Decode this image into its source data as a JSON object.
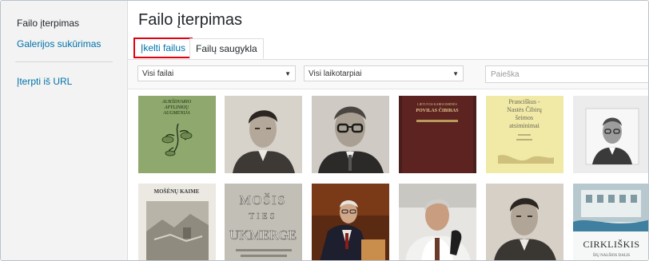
{
  "sidebar": {
    "items": [
      {
        "label": "Failo įterpimas"
      },
      {
        "label": "Galerijos sukūrimas"
      },
      {
        "label": "Įterpti iš URL"
      }
    ]
  },
  "main": {
    "title": "Failo įterpimas",
    "tabs": [
      {
        "label": "Įkelti failus"
      },
      {
        "label": "Failų saugykla"
      }
    ],
    "filters": {
      "type": "Visi failai",
      "date": "Visi laikotarpiai",
      "search_placeholder": "Paieška"
    }
  },
  "thumbnails": {
    "t1": {
      "lines": [
        "AUKŠDVARIO",
        "APYLINKIŲ",
        "AUGMENIJA"
      ],
      "icon": "plant-drawing"
    },
    "t2": {
      "icon": "portrait-photo"
    },
    "t3": {
      "icon": "portrait-photo-glasses"
    },
    "t4": {
      "lines": [
        "LIETUVOS KARIUOMENĖS",
        "POVILAS ČIBIRAS"
      ],
      "icon": "book-cover"
    },
    "t5": {
      "lines": [
        "Pranciškus -",
        "Nastės Čibirų",
        "šeimos",
        "atsiminimai"
      ],
      "icon": "book-cover"
    },
    "t6": {
      "icon": "portrait-photo-framed"
    },
    "t7": {
      "lines": [
        "MOŠĖNŲ KAIME"
      ],
      "icon": "book-cover"
    },
    "t8": {
      "lines": [
        "MOŠIS",
        "TIES",
        "UKMERGE"
      ],
      "icon": "book-cover"
    },
    "t9": {
      "icon": "lecture-photo"
    },
    "t10": {
      "icon": "portrait-photo"
    },
    "t11": {
      "icon": "portrait-photo"
    },
    "t12": {
      "lines": [
        "CIRKLIŠKIS",
        "ŠIŲ NALŠIOS DALIS"
      ],
      "icon": "book-cover"
    }
  },
  "colors": {
    "link": "#0073aa",
    "highlight_border": "#e3000f",
    "sidebar_bg": "#f3f3f3"
  }
}
